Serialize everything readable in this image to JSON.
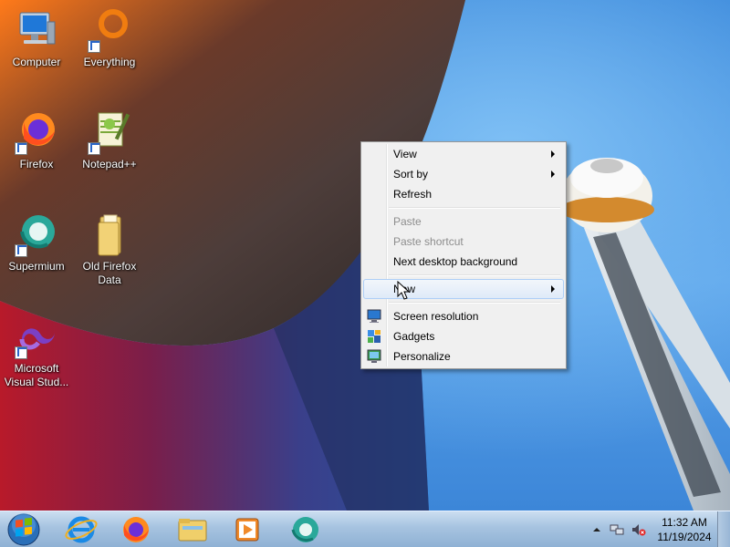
{
  "desktop": {
    "icons": [
      {
        "label": "Computer"
      },
      {
        "label": "Everything"
      },
      {
        "label": "Firefox"
      },
      {
        "label": "Notepad++"
      },
      {
        "label": "Supermium"
      },
      {
        "label": "Old Firefox\nData"
      },
      {
        "label": "Microsoft\nVisual Stud..."
      }
    ]
  },
  "context_menu": {
    "items": [
      {
        "label": "View",
        "has_submenu": true,
        "disabled": false
      },
      {
        "label": "Sort by",
        "has_submenu": true,
        "disabled": false
      },
      {
        "label": "Refresh",
        "has_submenu": false,
        "disabled": false
      },
      {
        "label": "Paste",
        "has_submenu": false,
        "disabled": true
      },
      {
        "label": "Paste shortcut",
        "has_submenu": false,
        "disabled": true
      },
      {
        "label": "Next desktop background",
        "has_submenu": false,
        "disabled": false
      },
      {
        "label": "New",
        "has_submenu": true,
        "disabled": false,
        "highlighted": true
      },
      {
        "label": "Screen resolution",
        "icon": "monitor-icon",
        "has_submenu": false,
        "disabled": false
      },
      {
        "label": "Gadgets",
        "icon": "gadgets-icon",
        "has_submenu": false,
        "disabled": false
      },
      {
        "label": "Personalize",
        "icon": "personalize-icon",
        "has_submenu": false,
        "disabled": false
      }
    ]
  },
  "taskbar": {
    "pinned": [
      "internet-explorer-icon",
      "firefox-icon",
      "file-explorer-icon",
      "media-player-icon",
      "supermium-icon"
    ],
    "clock": {
      "time": "11:32 AM",
      "date": "11/19/2024"
    }
  }
}
